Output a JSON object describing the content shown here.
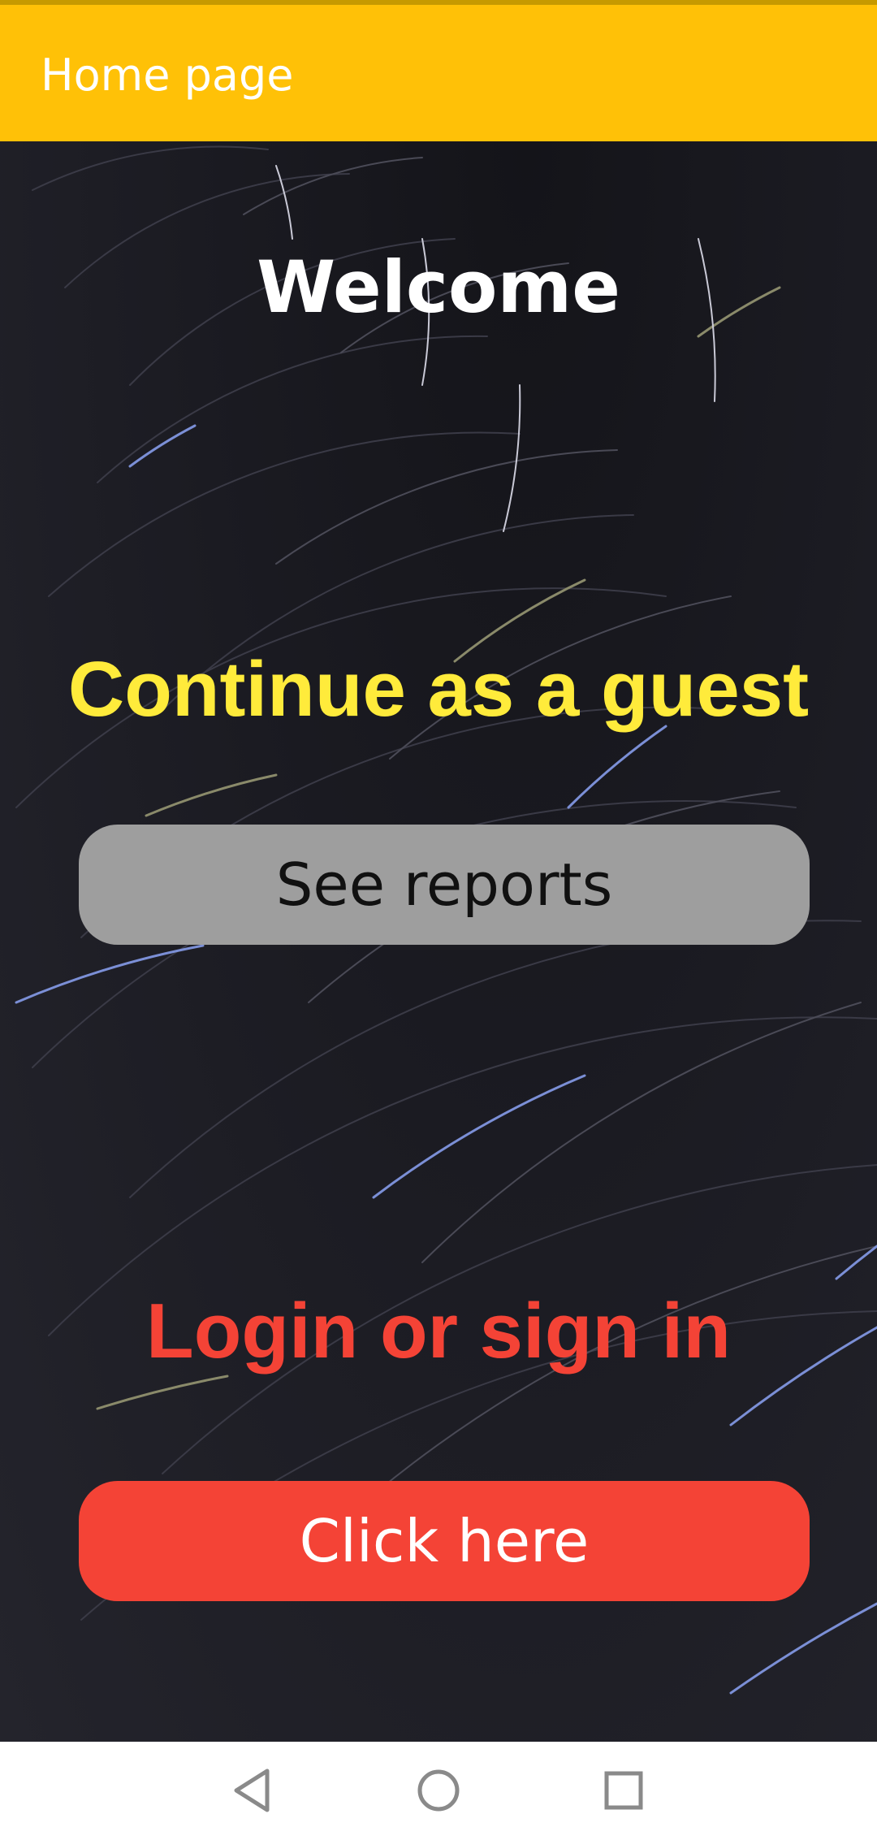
{
  "app_bar": {
    "title": "Home page"
  },
  "main": {
    "welcome": "Welcome",
    "guest_heading": "Continue as a guest",
    "reports_button": "See reports",
    "login_heading": "Login or sign in",
    "login_button": "Click here"
  },
  "nav_bar": {
    "back_icon": "triangle-back-icon",
    "home_icon": "circle-home-icon",
    "recents_icon": "square-recents-icon"
  },
  "colors": {
    "app_bar": "#FFC107",
    "guest_heading": "#FFEB3B",
    "reports_button": "#9E9E9E",
    "login_accent": "#F44336",
    "background": "#1b1b22"
  }
}
